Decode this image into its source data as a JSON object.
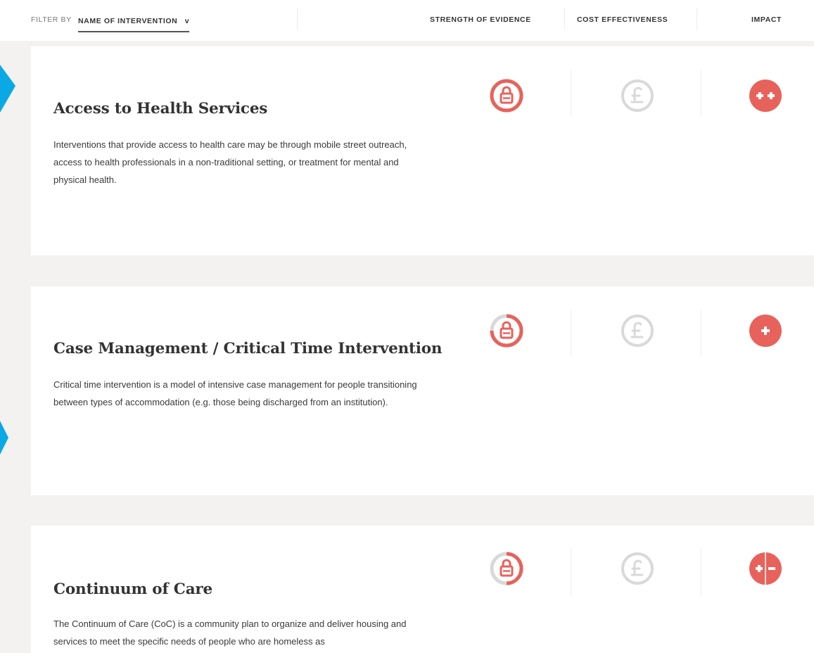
{
  "filter": {
    "label": "FILTER BY",
    "value": "NAME OF INTERVENTION",
    "chevron": "v"
  },
  "columns": {
    "strength": "STRENGTH OF EVIDENCE",
    "cost": "COST EFFECTIVENESS",
    "impact": "IMPACT"
  },
  "interventions": [
    {
      "title": "Access to Health Services",
      "description": "Interventions that provide access to health care may be through mobile street outreach, access to health professionals in a non-traditional setting, or treatment for mental and physical health.",
      "strength_icon": "evidence-padlock-icon",
      "strength_level": 1.0,
      "cost_icon": "pound-sign-icon",
      "impact_icon": "double-plus-icon",
      "impact_value": "++"
    },
    {
      "title": "Case Management / Critical Time Intervention",
      "description": "Critical time intervention is a model of intensive case management for people transitioning between types of accommodation (e.g. those being discharged from an institution).",
      "strength_icon": "evidence-padlock-icon",
      "strength_level": 0.75,
      "cost_icon": "pound-sign-icon",
      "impact_icon": "plus-icon",
      "impact_value": "+"
    },
    {
      "title": "Continuum of Care",
      "description": "The Continuum of Care (CoC) is a community plan to organize and deliver housing and services to meet the specific needs of people who are homeless as",
      "strength_icon": "evidence-padlock-icon",
      "strength_level": 0.5,
      "cost_icon": "pound-sign-icon",
      "impact_icon": "plus-minus-icon",
      "impact_value": "+-"
    }
  ],
  "colors": {
    "accent": "#e8625c",
    "muted": "#d9d9d9",
    "background": "#f3f2f1",
    "card": "#ffffff",
    "side_shape": "#0aa9e6"
  }
}
